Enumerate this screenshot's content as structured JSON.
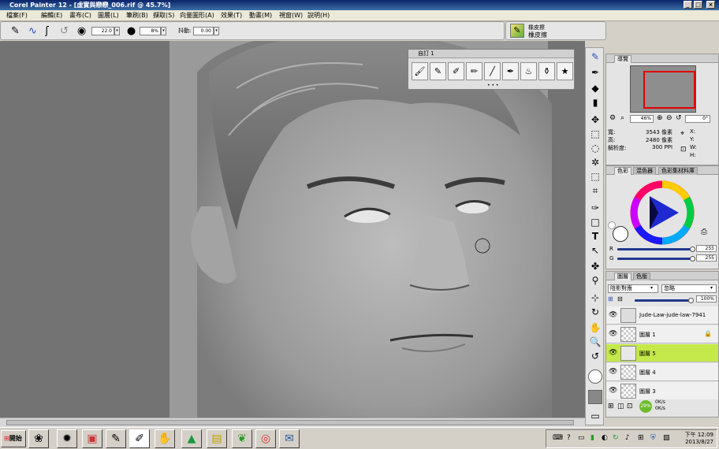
{
  "window": {
    "title": "Corel Painter 12 - [虛實與戀戀_006.rif @ 45.7%]",
    "min_label": "_",
    "max_label": "□",
    "close_label": "×"
  },
  "menu": [
    "檔案(F)",
    "編輯(E)",
    "畫布(C)",
    "圖層(L)",
    "筆刷(B)",
    "擷取(S)",
    "向量圖形(A)",
    "效果(T)",
    "動畫(M)",
    "視窗(W)",
    "說明(H)"
  ],
  "property_bar": {
    "size_value": "22.0",
    "opacity_value": "8%",
    "jitter_label": "抖動:",
    "jitter_value": "0.00"
  },
  "brush_selector": {
    "category": "橡皮擦",
    "variant": "橡皮擦"
  },
  "custom_palette": {
    "title": "自訂 1",
    "dots": "• • •"
  },
  "navigator": {
    "tab": "導覽",
    "zoom": "46%",
    "rotation": "0°",
    "width_label": "寬:",
    "width_value": "3543 像素",
    "height_label": "高:",
    "height_value": "2480 像素",
    "res_label": "解析度:",
    "res_value": "300 PPI",
    "x_label": "X:",
    "y_label": "Y:",
    "w_label": "W:",
    "h_label": "H:"
  },
  "color_panel": {
    "tabs": [
      "色彩",
      "混色器",
      "色彩集材料庫"
    ],
    "r_label": "R",
    "r_value": "255",
    "g_label": "G",
    "g_value": "255"
  },
  "layers_panel": {
    "tabs": [
      "圖層",
      "色版"
    ],
    "composite_method": "陰影對應",
    "composite_depth": "忽略",
    "opacity": "100%",
    "layers": [
      {
        "name": "Jude-Law-jude-law-7941",
        "selected": false
      },
      {
        "name": "圖層 1",
        "selected": false
      },
      {
        "name": "圖層 5",
        "selected": true
      },
      {
        "name": "圖層 4",
        "selected": false
      },
      {
        "name": "圖層 3",
        "selected": false
      }
    ],
    "badge_top": "0K/s",
    "badge_bottom": "0K/s",
    "badge_pct": "29%"
  },
  "taskbar": {
    "start_label": "開始",
    "clock_top": "下午 12:09",
    "clock_bottom": "2013/8/27"
  },
  "colors": {
    "accent": "#223a8c",
    "layer_selected": "#c5e84a",
    "title_bar": "#0a246a"
  }
}
